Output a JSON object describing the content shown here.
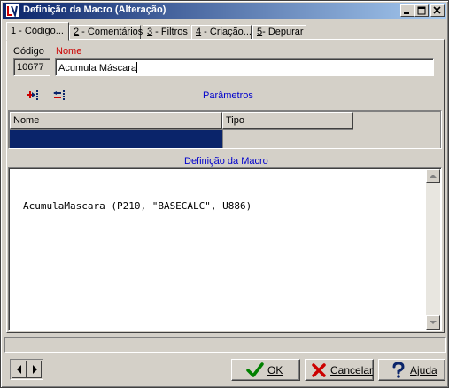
{
  "window": {
    "title": "Definição da Macro (Alteração)"
  },
  "tabs": [
    {
      "key": "1",
      "label": " - Código..."
    },
    {
      "key": "2",
      "label": " - Comentários"
    },
    {
      "key": "3",
      "label": " - Filtros"
    },
    {
      "key": "4",
      "label": " - Criação..."
    },
    {
      "key": "5",
      "label": "- Depurar"
    }
  ],
  "fields": {
    "codigo_label": "Código",
    "codigo_value": "10677",
    "nome_label": "Nome",
    "nome_value": "Acumula Máscara"
  },
  "parametros": {
    "label": "Parâmetros",
    "columns": [
      "Nome",
      "Tipo"
    ]
  },
  "definicao": {
    "label": "Definição da Macro",
    "code": "AcumulaMascara (P210, \"BASECALC\", U886)"
  },
  "buttons": {
    "ok": "OK",
    "cancel": "Cancelar",
    "help": "Ajuda"
  },
  "icons": {
    "app": "app-icon",
    "add_param": "add-parameter-icon",
    "remove_param": "remove-parameter-icon",
    "ok": "checkmark-icon",
    "cancel": "x-icon",
    "help": "question-icon"
  },
  "colors": {
    "titlebar_start": "#0a246a",
    "titlebar_end": "#a6caf0",
    "selection": "#0a246a",
    "label_blue": "#0000cc",
    "label_red": "#cc0000"
  }
}
